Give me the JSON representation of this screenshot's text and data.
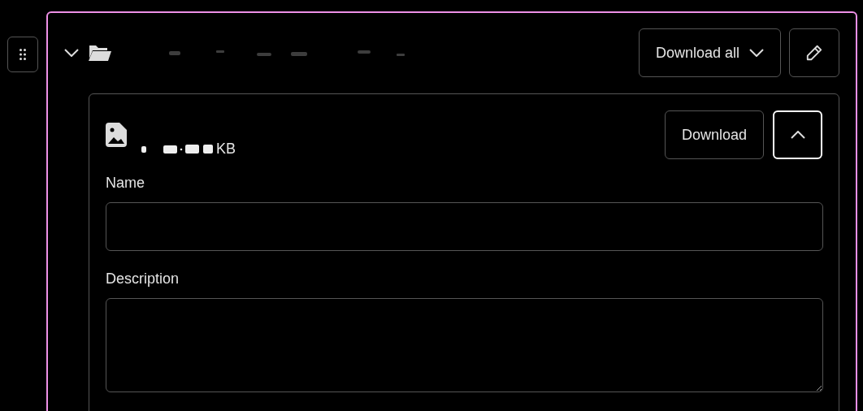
{
  "folder": {
    "expanded": true,
    "actions": {
      "download_all": "Download all"
    }
  },
  "file": {
    "size_suffix": "KB",
    "download": "Download",
    "expanded": true,
    "fields": [
      {
        "kind": "input",
        "label": "Name"
      },
      {
        "kind": "textarea",
        "label": "Description"
      }
    ]
  }
}
